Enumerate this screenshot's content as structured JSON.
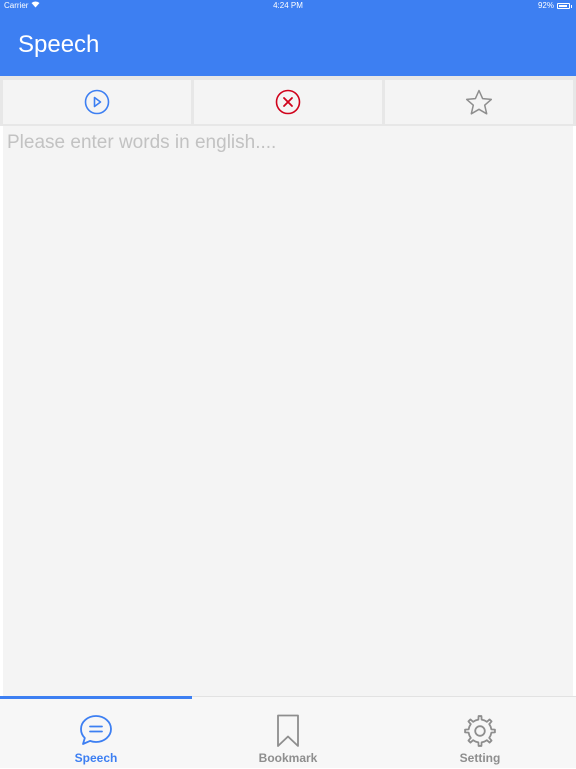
{
  "status_bar": {
    "carrier": "Carrier",
    "time": "4:24 PM",
    "battery": "92%",
    "battery_level": 0.92
  },
  "nav": {
    "title": "Speech"
  },
  "toolbar": {
    "play_icon": "play-circle-icon",
    "clear_icon": "close-circle-icon",
    "bookmark_icon": "star-outline-icon"
  },
  "editor": {
    "placeholder": "Please enter words in english....",
    "value": ""
  },
  "tabs": [
    {
      "label": "Speech",
      "icon": "chat-bubble-icon",
      "active": true
    },
    {
      "label": "Bookmark",
      "icon": "bookmark-icon",
      "active": false
    },
    {
      "label": "Setting",
      "icon": "gear-icon",
      "active": false
    }
  ],
  "colors": {
    "accent": "#3d7ff2",
    "clear_red": "#d0021b",
    "inactive_gray": "#8e8e8e"
  }
}
